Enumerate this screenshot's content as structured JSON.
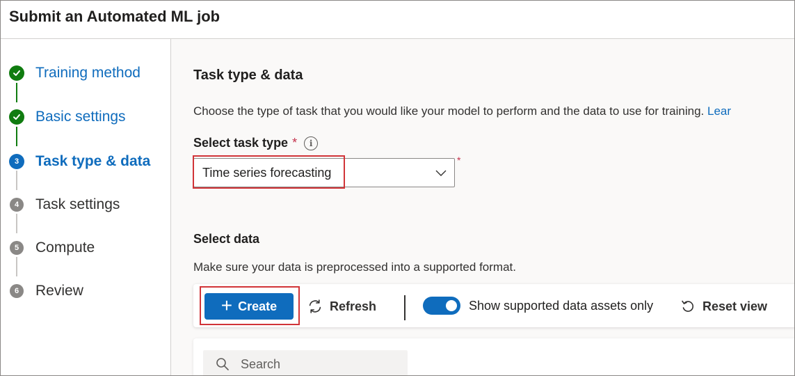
{
  "header": {
    "title": "Submit an Automated ML job"
  },
  "steps": [
    {
      "label": "Training method",
      "number": "1",
      "state": "done"
    },
    {
      "label": "Basic settings",
      "number": "2",
      "state": "done"
    },
    {
      "label": "Task type & data",
      "number": "3",
      "state": "current"
    },
    {
      "label": "Task settings",
      "number": "4",
      "state": "pending"
    },
    {
      "label": "Compute",
      "number": "5",
      "state": "pending"
    },
    {
      "label": "Review",
      "number": "6",
      "state": "pending"
    }
  ],
  "main": {
    "title": "Task type & data",
    "description": "Choose the type of task that you would like your model to perform and the data to use for training. ",
    "learn_more": "Lear",
    "task_type": {
      "label": "Select task type",
      "required_marker": "*",
      "info_icon": "info-icon",
      "value": "Time series forecasting"
    },
    "select_data": {
      "title": "Select data",
      "description": "Make sure your data is preprocessed into a supported format."
    },
    "toolbar": {
      "create_label": "Create",
      "refresh_label": "Refresh",
      "toggle_label": "Show supported data assets only",
      "toggle_on": true,
      "reset_label": "Reset view"
    },
    "search": {
      "placeholder": "Search"
    }
  },
  "colors": {
    "accent": "#0f6cbd",
    "done": "#107c10",
    "pending": "#8a8886",
    "required": "#c4314b",
    "highlight": "#d13438"
  }
}
